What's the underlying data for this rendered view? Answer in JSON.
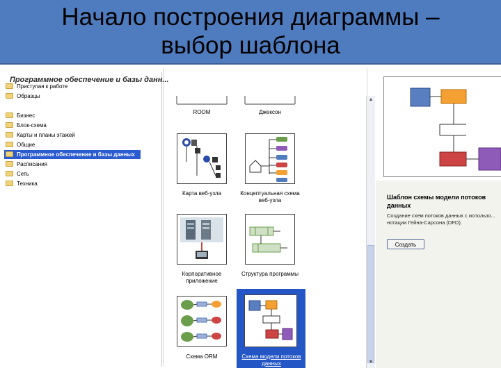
{
  "slide": {
    "title_line1": "Начало построения диаграммы –",
    "title_line2": "выбор шаблона",
    "title_bg": "#4f7bbf"
  },
  "sidebar": {
    "items": [
      {
        "label": "Приступая к работе"
      },
      {
        "label": "Образцы"
      },
      {
        "label": "Бизнес"
      },
      {
        "label": "Блок-схема"
      },
      {
        "label": "Карты и планы этажей"
      },
      {
        "label": "Общие"
      },
      {
        "label": "Программное обеспечение и базы данных",
        "selected": true
      },
      {
        "label": "Расписания"
      },
      {
        "label": "Сеть"
      },
      {
        "label": "Техника"
      }
    ],
    "selected_color": "#2b5bd1"
  },
  "templates": {
    "heading": "Программное обеспечение и базы данн...",
    "items": [
      {
        "label": "ROOM",
        "icon": "room-template-icon"
      },
      {
        "label": "Джексон",
        "icon": "jackson-template-icon"
      },
      {
        "label": "Карта веб-узла",
        "icon": "website-map-icon"
      },
      {
        "label": "Концептуальная схема веб-узла",
        "icon": "conceptual-website-icon"
      },
      {
        "label": "Корпоративное приложение",
        "icon": "enterprise-app-icon"
      },
      {
        "label": "Структура программы",
        "icon": "program-structure-icon"
      },
      {
        "label": "Схема ORM",
        "icon": "orm-diagram-icon"
      },
      {
        "label": "Схема модели потоков данных",
        "icon": "data-flow-model-icon",
        "selected": true
      }
    ]
  },
  "details": {
    "title": "Шаблон схемы модели потоков данных",
    "description": "Создание схем потоков данных с использо... нотации Гейна-Сарсона (DFD).",
    "create_label": "Создать"
  },
  "colors": {
    "blue_box": "#5a7fc0",
    "orange_box": "#f5a033",
    "red_box": "#cc4444",
    "purple_box": "#8e5bb8",
    "green_box": "#7fbf6a",
    "selection": "#2456c6"
  }
}
